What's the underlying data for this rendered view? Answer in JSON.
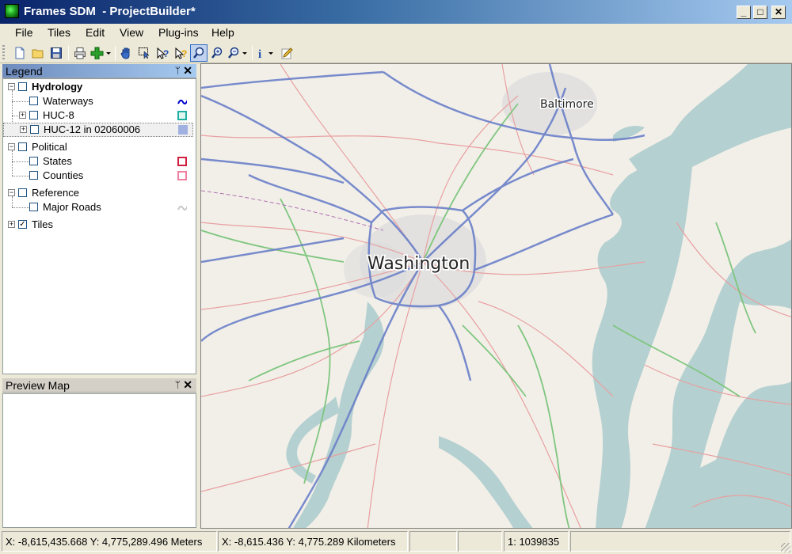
{
  "window": {
    "title": "Frames SDM  - ProjectBuilder*",
    "minimize": "_",
    "maximize": "□",
    "close": "✕"
  },
  "menu": [
    "File",
    "Tiles",
    "Edit",
    "View",
    "Plug-ins",
    "Help"
  ],
  "toolbar": {
    "tools": [
      "new-file-icon",
      "open-folder-icon",
      "save-icon",
      "print-icon",
      "add-layer-icon",
      "pan-hand-icon",
      "select-icon",
      "help-query-icon",
      "context-help-icon",
      "zoom-rect-icon",
      "zoom-in-icon",
      "zoom-out-icon",
      "info-icon",
      "edit-icon"
    ],
    "active_tool": "zoom-rect-icon"
  },
  "legend": {
    "title": "Legend",
    "pin": "ᛘ",
    "close": "✕",
    "groups": [
      {
        "label": "Hydrology",
        "expander": "−",
        "checked": "",
        "children": [
          {
            "label": "Waterways",
            "expander": "",
            "checked": "",
            "symbol": "waterways-symbol",
            "color": "#0000cc"
          },
          {
            "label": "HUC-8",
            "expander": "+",
            "checked": "",
            "symbol": "huc8-symbol",
            "color": "#20b0a0"
          },
          {
            "label": "HUC-12 in 02060006",
            "expander": "+",
            "checked": "",
            "symbol": "huc12-symbol",
            "color": "#a0b0e0"
          }
        ]
      },
      {
        "label": "Political",
        "expander": "−",
        "checked": "",
        "children": [
          {
            "label": "States",
            "expander": "",
            "checked": "",
            "symbol": "states-symbol",
            "color": "#d02040"
          },
          {
            "label": "Counties",
            "expander": "",
            "checked": "",
            "symbol": "counties-symbol",
            "color": "#f080a0"
          }
        ]
      },
      {
        "label": "Reference",
        "expander": "−",
        "checked": "",
        "children": [
          {
            "label": "Major Roads",
            "expander": "",
            "checked": "",
            "symbol": "roads-symbol",
            "color": "#c8c8c8"
          }
        ]
      },
      {
        "label": "Tiles",
        "expander": "+",
        "checked": "✓",
        "children": []
      }
    ]
  },
  "preview": {
    "title": "Preview Map",
    "pin": "ᛘ",
    "close": "✕"
  },
  "map": {
    "labels": {
      "baltimore": "Baltimore",
      "washington": "Washington"
    },
    "colors": {
      "land": "#f2efe9",
      "water": "#b5d0d0",
      "urban": "#dcdcdc",
      "motorway": "#6a80c8",
      "trunk": "#7fc67f",
      "primary": "#e8a0a0"
    }
  },
  "status": {
    "coords_meters": "X: -8,615,435.668 Y: 4,775,289.496 Meters",
    "coords_km": "X: -8,615.436 Y: 4,775.289 Kilometers",
    "scale": "1: 1039835"
  }
}
